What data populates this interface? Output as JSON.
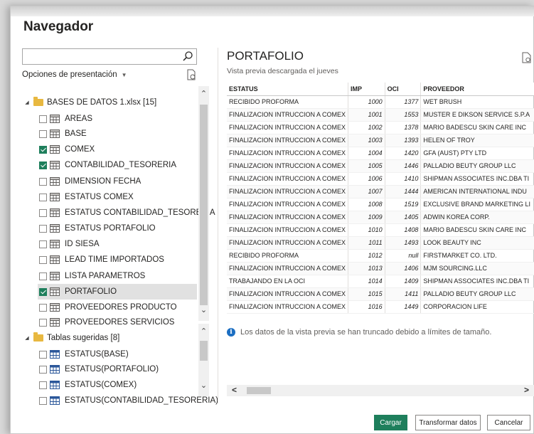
{
  "dialog": {
    "title": "Navegador"
  },
  "left": {
    "search_placeholder": "",
    "options_label": "Opciones de presentación",
    "groups": [
      {
        "label": "BASES DE DATOS 1.xlsx [15]",
        "items": [
          {
            "label": "AREAS",
            "checked": false
          },
          {
            "label": "BASE",
            "checked": false
          },
          {
            "label": "COMEX",
            "checked": true
          },
          {
            "label": "CONTABILIDAD_TESORERIA",
            "checked": true
          },
          {
            "label": "DIMENSION FECHA",
            "checked": false
          },
          {
            "label": "ESTATUS COMEX",
            "checked": false
          },
          {
            "label": "ESTATUS CONTABILIDAD_TESORERIA",
            "checked": false
          },
          {
            "label": "ESTATUS PORTAFOLIO",
            "checked": false
          },
          {
            "label": "ID SIESA",
            "checked": false
          },
          {
            "label": "LEAD TIME IMPORTADOS",
            "checked": false
          },
          {
            "label": "LISTA PARAMETROS",
            "checked": false
          },
          {
            "label": "PORTAFOLIO",
            "checked": true,
            "selected": true
          },
          {
            "label": "PROVEEDORES PRODUCTO",
            "checked": false
          },
          {
            "label": "PROVEEDORES SERVICIOS",
            "checked": false
          }
        ]
      },
      {
        "label": "Tablas sugeridas [8]",
        "items": [
          {
            "label": "ESTATUS(BASE)",
            "checked": false
          },
          {
            "label": "ESTATUS(PORTAFOLIO)",
            "checked": false
          },
          {
            "label": "ESTATUS(COMEX)",
            "checked": false
          },
          {
            "label": "ESTATUS(CONTABILIDAD_TESORERIA)",
            "checked": false
          }
        ]
      }
    ]
  },
  "preview": {
    "title": "PORTAFOLIO",
    "subtitle": "Vista previa descargada el jueves",
    "columns": [
      "ESTATUS",
      "IMP",
      "OCI",
      "PROVEEDOR"
    ],
    "rows": [
      [
        "RECIBIDO PROFORMA",
        "1000",
        "1377",
        "WET BRUSH"
      ],
      [
        "FINALIZACION INTRUCCION A COMEX",
        "1001",
        "1553",
        "MUSTER E DIKSON SERVICE S.P.A"
      ],
      [
        "FINALIZACION INTRUCCION A COMEX",
        "1002",
        "1378",
        "MARIO BADESCU SKIN CARE INC"
      ],
      [
        "FINALIZACION INTRUCCION A COMEX",
        "1003",
        "1393",
        "HELEN OF TROY"
      ],
      [
        "FINALIZACION INTRUCCION A COMEX",
        "1004",
        "1420",
        "GFA (AUST) PTY LTD"
      ],
      [
        "FINALIZACION INTRUCCION A COMEX",
        "1005",
        "1446",
        "PALLADIO BEUTY GROUP LLC"
      ],
      [
        "FINALIZACION INTRUCCION A COMEX",
        "1006",
        "1410",
        "SHIPMAN ASSOCIATES INC.DBA TI"
      ],
      [
        "FINALIZACION INTRUCCION A COMEX",
        "1007",
        "1444",
        "AMERICAN INTERNATIONAL INDU"
      ],
      [
        "FINALIZACION INTRUCCION A COMEX",
        "1008",
        "1519",
        "EXCLUSIVE BRAND MARKETING LI"
      ],
      [
        "FINALIZACION INTRUCCION A COMEX",
        "1009",
        "1405",
        "ADWIN KOREA CORP."
      ],
      [
        "FINALIZACION INTRUCCION A COMEX",
        "1010",
        "1408",
        "MARIO BADESCU SKIN CARE INC"
      ],
      [
        "FINALIZACION INTRUCCION A COMEX",
        "1011",
        "1493",
        "LOOK BEAUTY INC"
      ],
      [
        "RECIBIDO PROFORMA",
        "1012",
        "null",
        "FIRSTMARKET CO. LTD."
      ],
      [
        "FINALIZACION INTRUCCION A COMEX",
        "1013",
        "1406",
        "MJM SOURCING.LLC"
      ],
      [
        "TRABAJANDO EN LA OCI",
        "1014",
        "1409",
        "SHIPMAN ASSOCIATES INC.DBA TI"
      ],
      [
        "FINALIZACION INTRUCCION A COMEX",
        "1015",
        "1411",
        "PALLADIO BEUTY GROUP LLC"
      ],
      [
        "FINALIZACION INTRUCCION A COMEX",
        "1016",
        "1449",
        "CORPORACION LIFE"
      ]
    ],
    "truncated_notice": "Los datos de la vista previa se han truncado debido a límites de tamaño."
  },
  "buttons": {
    "load": "Cargar",
    "transform": "Transformar datos",
    "cancel": "Cancelar"
  },
  "colors": {
    "accent": "#1e7f5c",
    "info": "#1b6ec2",
    "folder": "#e8b840"
  }
}
